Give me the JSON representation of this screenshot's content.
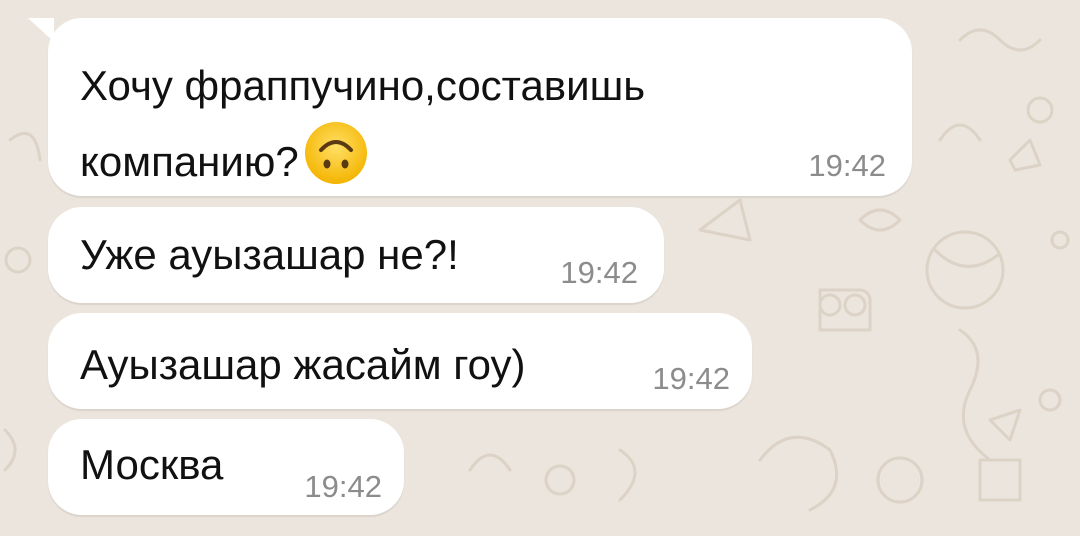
{
  "messages": [
    {
      "line1": "Хочу фраппучино,составишь",
      "line2": "компанию?",
      "emoji": "upside-down-face",
      "time": "19:42"
    },
    {
      "text": "Уже ауызашар не?!",
      "time": "19:42"
    },
    {
      "text": "Ауызашар жасайм гоу)",
      "time": "19:42"
    },
    {
      "text": "Москва",
      "time": "19:42"
    }
  ],
  "colors": {
    "background": "#ece5dd",
    "bubble": "#ffffff",
    "text": "#111111",
    "time": "#8c8c8c",
    "emoji": "#f6bf26"
  }
}
